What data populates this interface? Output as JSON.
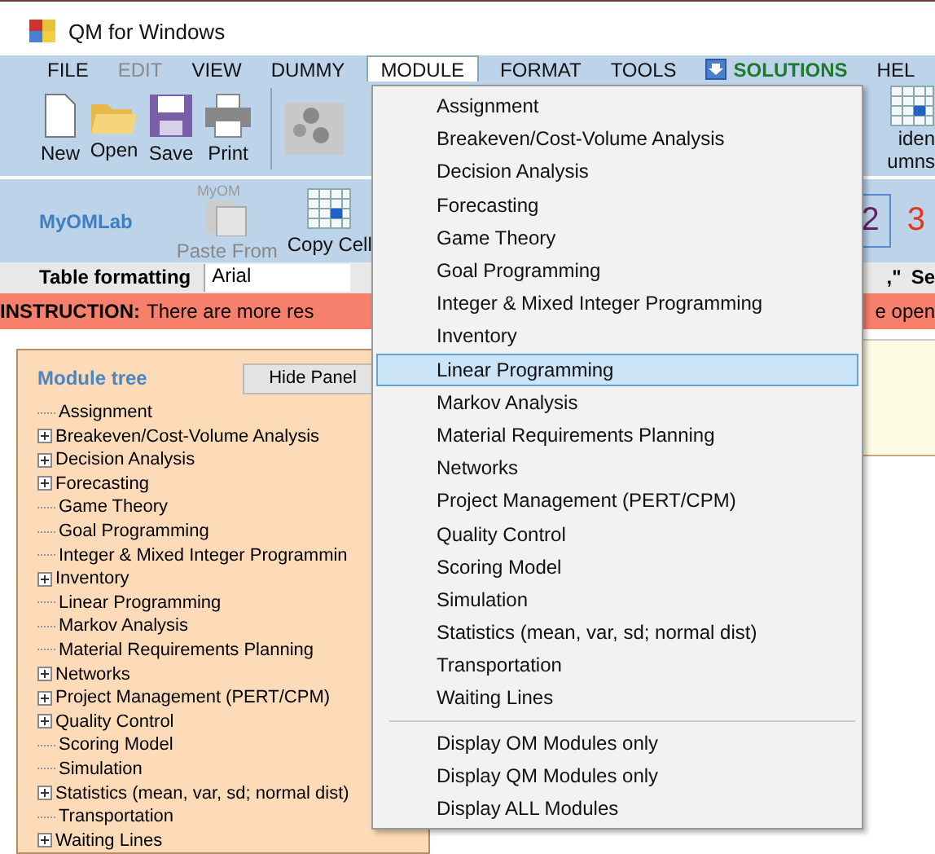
{
  "window": {
    "title": "QM for Windows"
  },
  "menu_bar": [
    {
      "label": "FILE",
      "disabled": false,
      "selected": false,
      "kind": "plain"
    },
    {
      "label": "EDIT",
      "disabled": true,
      "selected": false,
      "kind": "plain"
    },
    {
      "label": "VIEW",
      "disabled": false,
      "selected": false,
      "kind": "plain"
    },
    {
      "label": "DUMMY",
      "disabled": false,
      "selected": false,
      "kind": "plain"
    },
    {
      "label": "MODULE",
      "disabled": false,
      "selected": true,
      "kind": "plain"
    },
    {
      "label": "FORMAT",
      "disabled": false,
      "selected": false,
      "kind": "plain"
    },
    {
      "label": "TOOLS",
      "disabled": false,
      "selected": false,
      "kind": "plain"
    },
    {
      "label": "SOLUTIONS",
      "disabled": false,
      "selected": false,
      "kind": "solutions"
    },
    {
      "label": "HEL",
      "disabled": false,
      "selected": false,
      "kind": "plain"
    }
  ],
  "toolbar": {
    "buttons": [
      {
        "label": "New",
        "kind": "new"
      },
      {
        "label": "Open",
        "kind": "open"
      },
      {
        "label": "Save",
        "kind": "save"
      },
      {
        "label": "Print",
        "kind": "print"
      }
    ],
    "right_button": {
      "lines": [
        "iden",
        "umns"
      ]
    }
  },
  "toolbar_2": {
    "link": "MyOMLab",
    "paste": {
      "icon_text": "MyOM",
      "label": "Paste From",
      "disabled": true
    },
    "copy": {
      "label": "Copy Cell"
    },
    "numbers": [
      "2",
      "3"
    ]
  },
  "format_bar": {
    "label": "Table formatting",
    "font": "Arial",
    "right_text": ",\"",
    "right_label": "Se"
  },
  "instruction": {
    "label": "INSTRUCTION:",
    "text": "There are more res",
    "tail": "e open"
  },
  "module_tree": {
    "title": "Module tree",
    "hide_button": "Hide Panel",
    "items": [
      {
        "label": "Assignment",
        "kind": "leaf"
      },
      {
        "label": "Breakeven/Cost-Volume Analysis",
        "kind": "folder"
      },
      {
        "label": "Decision Analysis",
        "kind": "folder"
      },
      {
        "label": "Forecasting",
        "kind": "folder"
      },
      {
        "label": "Game Theory",
        "kind": "leaf"
      },
      {
        "label": "Goal Programming",
        "kind": "leaf"
      },
      {
        "label": "Integer & Mixed Integer Programmin",
        "kind": "leaf"
      },
      {
        "label": "Inventory",
        "kind": "folder"
      },
      {
        "label": "Linear Programming",
        "kind": "leaf"
      },
      {
        "label": "Markov Analysis",
        "kind": "leaf"
      },
      {
        "label": "Material Requirements Planning",
        "kind": "leaf"
      },
      {
        "label": "Networks",
        "kind": "folder"
      },
      {
        "label": "Project Management (PERT/CPM)",
        "kind": "folder"
      },
      {
        "label": "Quality Control",
        "kind": "folder"
      },
      {
        "label": "Scoring Model",
        "kind": "leaf"
      },
      {
        "label": "Simulation",
        "kind": "leaf"
      },
      {
        "label": "Statistics (mean, var, sd; normal dist)",
        "kind": "folder"
      },
      {
        "label": "Transportation",
        "kind": "leaf"
      },
      {
        "label": "Waiting Lines",
        "kind": "folder"
      }
    ]
  },
  "module_menu": {
    "modules": [
      {
        "label": "Assignment",
        "selected": false
      },
      {
        "label": "Breakeven/Cost-Volume Analysis",
        "selected": false
      },
      {
        "label": "Decision Analysis",
        "selected": false
      },
      {
        "label": "Forecasting",
        "selected": false
      },
      {
        "label": "Game Theory",
        "selected": false
      },
      {
        "label": "Goal Programming",
        "selected": false
      },
      {
        "label": "Integer & Mixed Integer Programming",
        "selected": false
      },
      {
        "label": "Inventory",
        "selected": false
      },
      {
        "label": "Linear Programming",
        "selected": true
      },
      {
        "label": "Markov Analysis",
        "selected": false
      },
      {
        "label": "Material Requirements Planning",
        "selected": false
      },
      {
        "label": "Networks",
        "selected": false
      },
      {
        "label": "Project Management (PERT/CPM)",
        "selected": false
      },
      {
        "label": "Quality Control",
        "selected": false
      },
      {
        "label": "Scoring Model",
        "selected": false
      },
      {
        "label": "Simulation",
        "selected": false
      },
      {
        "label": "Statistics (mean, var, sd; normal dist)",
        "selected": false
      },
      {
        "label": "Transportation",
        "selected": false
      },
      {
        "label": "Waiting Lines",
        "selected": false
      }
    ],
    "display_options": [
      "Display OM Modules only",
      "Display QM Modules only",
      "Display ALL Modules"
    ]
  }
}
